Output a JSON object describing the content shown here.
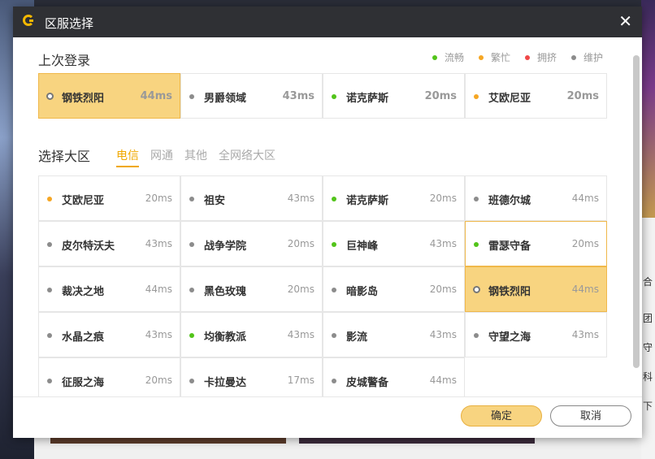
{
  "dialog": {
    "title": "区服选择",
    "close_glyph": "✕"
  },
  "legend": [
    {
      "label": "流畅",
      "color": "#52c41a"
    },
    {
      "label": "繁忙",
      "color": "#f5a623"
    },
    {
      "label": "拥挤",
      "color": "#f04848"
    },
    {
      "label": "维护",
      "color": "#8c8c8c"
    }
  ],
  "last_login": {
    "title": "上次登录",
    "servers": [
      {
        "name": "钢铁烈阳",
        "ping": "44ms",
        "status": "selected",
        "color": "#8c8c8c"
      },
      {
        "name": "男爵领域",
        "ping": "43ms",
        "status": "maintenance",
        "color": "#8c8c8c"
      },
      {
        "name": "诺克萨斯",
        "ping": "20ms",
        "status": "smooth",
        "color": "#52c41a"
      },
      {
        "name": "艾欧尼亚",
        "ping": "20ms",
        "status": "busy",
        "color": "#f5a623"
      }
    ]
  },
  "region": {
    "title": "选择大区",
    "tabs": [
      "电信",
      "网通",
      "其他",
      "全网络大区"
    ],
    "active_tab": "电信",
    "servers": [
      {
        "name": "艾欧尼亚",
        "ping": "20ms",
        "color": "#f5a623"
      },
      {
        "name": "祖安",
        "ping": "43ms",
        "color": "#8c8c8c"
      },
      {
        "name": "诺克萨斯",
        "ping": "20ms",
        "color": "#52c41a"
      },
      {
        "name": "班德尔城",
        "ping": "44ms",
        "color": "#8c8c8c"
      },
      {
        "name": "皮尔特沃夫",
        "ping": "43ms",
        "color": "#8c8c8c"
      },
      {
        "name": "战争学院",
        "ping": "20ms",
        "color": "#8c8c8c"
      },
      {
        "name": "巨神峰",
        "ping": "43ms",
        "color": "#52c41a"
      },
      {
        "name": "雷瑟守备",
        "ping": "20ms",
        "color": "#52c41a",
        "state": "hover"
      },
      {
        "name": "裁决之地",
        "ping": "44ms",
        "color": "#8c8c8c"
      },
      {
        "name": "黑色玫瑰",
        "ping": "20ms",
        "color": "#8c8c8c"
      },
      {
        "name": "暗影岛",
        "ping": "20ms",
        "color": "#8c8c8c"
      },
      {
        "name": "钢铁烈阳",
        "ping": "44ms",
        "color": "#8c8c8c",
        "state": "selected"
      },
      {
        "name": "水晶之痕",
        "ping": "43ms",
        "color": "#8c8c8c"
      },
      {
        "name": "均衡教派",
        "ping": "43ms",
        "color": "#52c41a"
      },
      {
        "name": "影流",
        "ping": "43ms",
        "color": "#8c8c8c"
      },
      {
        "name": "守望之海",
        "ping": "43ms",
        "color": "#8c8c8c"
      },
      {
        "name": "征服之海",
        "ping": "20ms",
        "color": "#8c8c8c"
      },
      {
        "name": "卡拉曼达",
        "ping": "17ms",
        "color": "#8c8c8c"
      },
      {
        "name": "皮城警备",
        "ping": "44ms",
        "color": "#8c8c8c"
      }
    ]
  },
  "footer": {
    "ok_label": "确定",
    "cancel_label": "取消"
  },
  "background_side_text": [
    "合",
    "团",
    "守",
    "科",
    "下"
  ]
}
